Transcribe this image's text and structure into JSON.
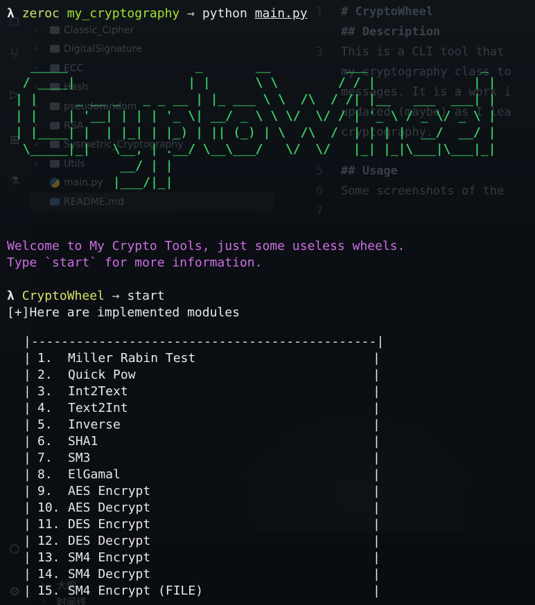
{
  "background_ide": {
    "explorer_items": [
      {
        "label": "Classic_Cipher",
        "kind": "folder"
      },
      {
        "label": "DigitalSignature",
        "kind": "folder"
      },
      {
        "label": "ECC",
        "kind": "folder"
      },
      {
        "label": "Hash",
        "kind": "folder"
      },
      {
        "label": "pseudorandom",
        "kind": "folder"
      },
      {
        "label": "RSA",
        "kind": "folder"
      },
      {
        "label": "Sysmetric_Cryptography",
        "kind": "folder"
      },
      {
        "label": "Utils",
        "kind": "folder"
      },
      {
        "label": "main.py",
        "kind": "python-file"
      },
      {
        "label": "README.md",
        "kind": "markdown-file",
        "selected": true
      }
    ],
    "editor_lines": [
      {
        "num": "1",
        "text": "# CryptoWheel",
        "heading": true
      },
      {
        "num": "",
        "text": "## Description",
        "heading": true
      },
      {
        "num": "3",
        "text": "This is a CLI tool that",
        "heading": false
      },
      {
        "num": "",
        "text": "my cryptography class to",
        "heading": false
      },
      {
        "num": "",
        "text": "messages. It is a work i",
        "heading": false
      },
      {
        "num": "",
        "text": "updated (maybe) as I lea",
        "heading": false
      },
      {
        "num": "",
        "text": "cryptography.",
        "heading": false
      },
      {
        "num": "5",
        "text": "## Usage",
        "heading": true
      },
      {
        "num": "6",
        "text": "Some screenshots of the",
        "heading": false
      },
      {
        "num": "7",
        "text": "",
        "heading": false
      }
    ],
    "bottom_items": [
      "大纲",
      "时间线"
    ]
  },
  "terminal": {
    "prompt1": {
      "lambda": "λ",
      "user": "zeroc",
      "cwd": "my_cryptography",
      "arrow": "→",
      "command": "python",
      "argument": "main.py"
    },
    "ascii_art": "  _____                 _       __          ___               _ \n / ____|               | |      \\ \\        / / |             | |\n| |     _ __ _   _ _ __ | |_ ___ \\ \\  /\\  / /| |__   ___  ___| |\n| |    | '__| | | | '_ \\| __/ _ \\ \\ \\/  \\/ / | '_ \\ / _ \\/ _ \\ |\n| |____| |  | |_| | |_) | || (_) | \\  /\\  /  | | | |  __/  __/ |\n \\_____|_|   \\__, | .__/ \\__\\___/   \\/  \\/   |_| |_|\\___|\\___|_|\n              __/ | |                                          \n             |___/|_|                                          ",
    "welcome_line1": "Welcome to My Crypto Tools, just some useless wheels.",
    "welcome_line2": "Type `start` for more information.",
    "prompt2": {
      "lambda": "λ",
      "name": "CryptoWheel",
      "arrow": "→",
      "command": "start"
    },
    "modules_header": "[+]Here are implemented modules",
    "menu_top_border": "|----------------------------------------------|",
    "menu_items": [
      {
        "num": "1.",
        "name": "Miller Rabin Test"
      },
      {
        "num": "2.",
        "name": "Quick Pow"
      },
      {
        "num": "3.",
        "name": "Int2Text"
      },
      {
        "num": "4.",
        "name": "Text2Int"
      },
      {
        "num": "5.",
        "name": "Inverse"
      },
      {
        "num": "6.",
        "name": "SHA1"
      },
      {
        "num": "7.",
        "name": "SM3"
      },
      {
        "num": "8.",
        "name": "ElGamal"
      },
      {
        "num": "9.",
        "name": "AES Encrypt"
      },
      {
        "num": "10.",
        "name": "AES Decrypt"
      },
      {
        "num": "11.",
        "name": "DES Encrypt"
      },
      {
        "num": "12.",
        "name": "DES Decrypt"
      },
      {
        "num": "13.",
        "name": "SM4 Encrypt"
      },
      {
        "num": "14.",
        "name": "SM4 Decrypt"
      },
      {
        "num": "15.",
        "name": "SM4 Encrypt (FILE)"
      }
    ]
  },
  "colors": {
    "background": "#0b0f14",
    "ascii_green": "#3fd969",
    "prompt_yellow": "#d7e068",
    "cwd_green": "#a6e22e",
    "welcome_magenta": "#cc6fe0",
    "text": "#e8e8e8"
  }
}
